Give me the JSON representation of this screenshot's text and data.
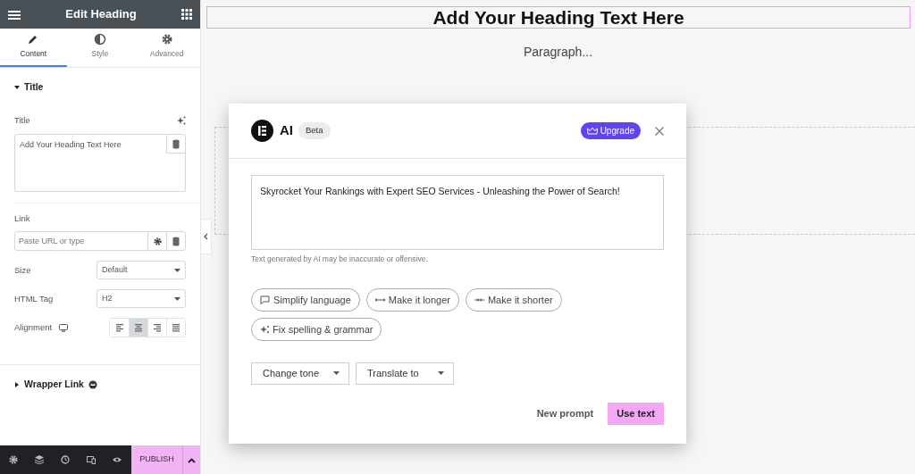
{
  "panel": {
    "title": "Edit Heading",
    "tabs": [
      {
        "label": "Content",
        "kind": "pencil",
        "selected": true
      },
      {
        "label": "Style",
        "kind": "contrast",
        "selected": false
      },
      {
        "label": "Advanced",
        "kind": "gear",
        "selected": false
      }
    ],
    "sections": [
      {
        "title": "Title",
        "expanded": true,
        "controls": [
          {
            "kind": "textarea",
            "label": "Title",
            "value": "Add Your Heading Text Here"
          },
          {
            "kind": "url",
            "label": "Link",
            "placeholder": "Paste URL or type"
          },
          {
            "kind": "select",
            "label": "Size",
            "value": "Default"
          },
          {
            "kind": "select",
            "label": "HTML Tag",
            "value": "H2"
          },
          {
            "kind": "align",
            "label": "Alignment",
            "options": [
              {
                "kind": "left",
                "selected": false
              },
              {
                "kind": "center",
                "selected": true
              },
              {
                "kind": "right",
                "selected": false
              },
              {
                "kind": "justify",
                "selected": false
              }
            ]
          }
        ]
      },
      {
        "title": "Wrapper Link",
        "expanded": false
      }
    ],
    "publish": "PUBLISH"
  },
  "canvas": {
    "heading": "Add Your Heading Text Here",
    "paragraph": "Paragraph..."
  },
  "ai_dialog": {
    "title": "AI",
    "badge": "Beta",
    "upgrade": "Upgrade",
    "result": "Skyrocket Your Rankings with Expert SEO Services - Unleashing the Power of Search!",
    "disclaimer": "Text generated by AI may be inaccurate or offensive.",
    "actions": [
      {
        "label": "Simplify language",
        "kind": "speech"
      },
      {
        "label": "Make it longer",
        "kind": "expand"
      },
      {
        "label": "Make it shorter",
        "kind": "shrink"
      },
      {
        "label": "Fix spelling & grammar",
        "kind": "sparkle"
      }
    ],
    "dropdowns": [
      "Change tone",
      "Translate to"
    ],
    "new_prompt": "New prompt",
    "use_text": "Use text"
  }
}
